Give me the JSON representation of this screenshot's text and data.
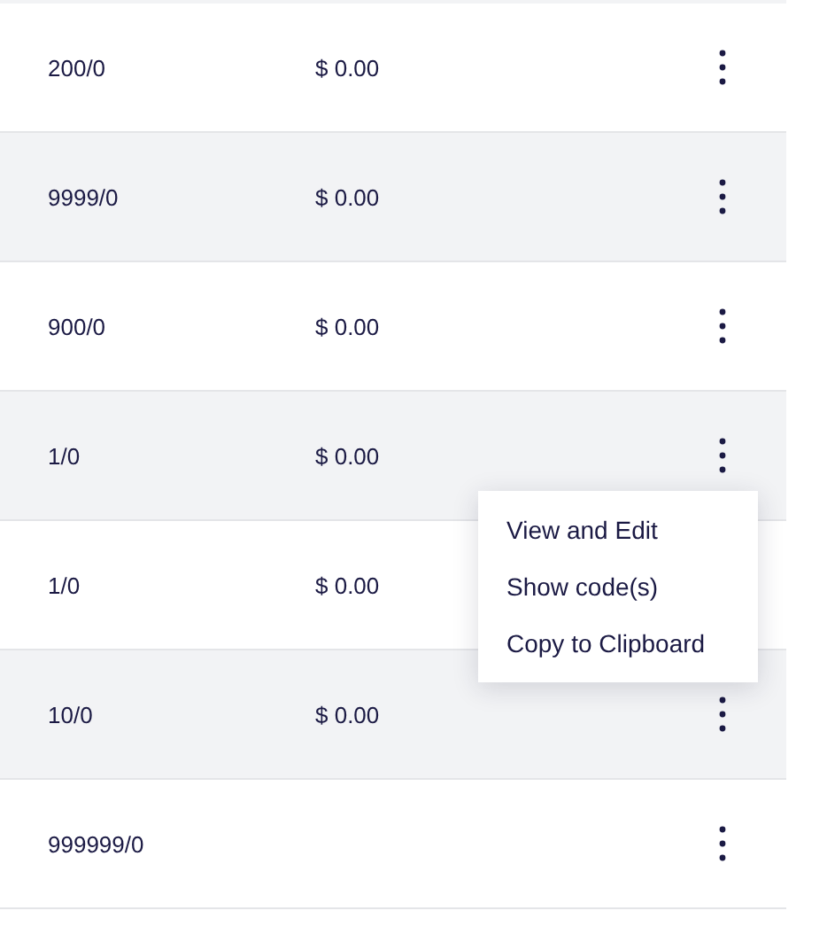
{
  "rows": [
    {
      "quantity": "200/0",
      "amount": "$ 0.00"
    },
    {
      "quantity": "9999/0",
      "amount": "$ 0.00"
    },
    {
      "quantity": "900/0",
      "amount": "$ 0.00"
    },
    {
      "quantity": "1/0",
      "amount": "$ 0.00"
    },
    {
      "quantity": "1/0",
      "amount": "$ 0.00"
    },
    {
      "quantity": "10/0",
      "amount": "$ 0.00"
    },
    {
      "quantity": "999999/0"
    }
  ],
  "context_menu": {
    "items": [
      "View and Edit",
      "Show code(s)",
      "Copy to Clipboard"
    ]
  }
}
